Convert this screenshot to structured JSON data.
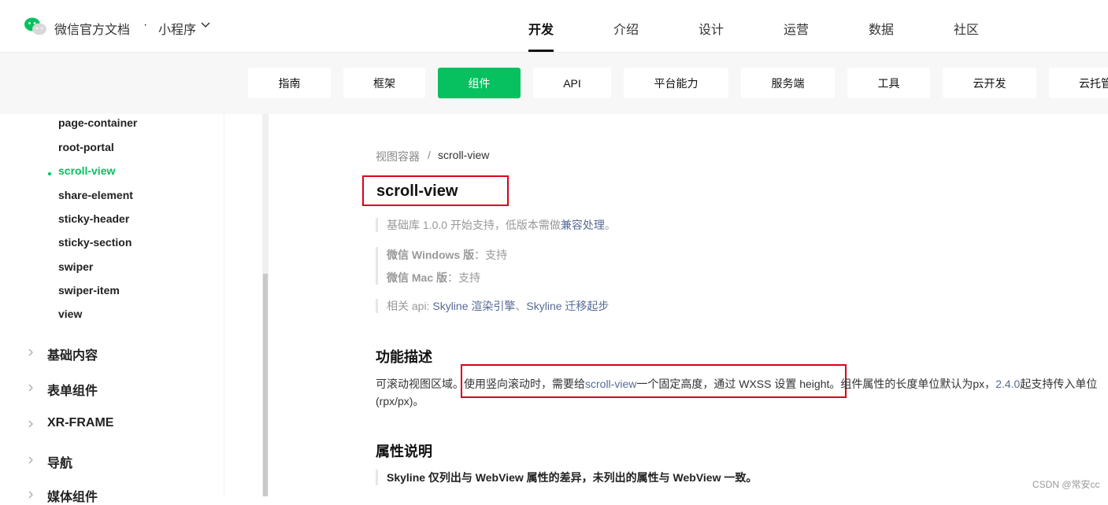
{
  "header": {
    "brand": "微信官方文档",
    "dot": "·",
    "product": "小程序",
    "nav": [
      "开发",
      "介绍",
      "设计",
      "运营",
      "数据",
      "社区"
    ],
    "active_nav": "开发"
  },
  "subnav": {
    "items": [
      "指南",
      "框架",
      "组件",
      "API",
      "平台能力",
      "服务端",
      "工具",
      "云开发",
      "云托管"
    ],
    "active": "组件",
    "accent": "#07c160"
  },
  "sidebar": {
    "sub_items": [
      "page-container",
      "root-portal",
      "scroll-view",
      "share-element",
      "sticky-header",
      "sticky-section",
      "swiper",
      "swiper-item",
      "view"
    ],
    "active_item": "scroll-view",
    "categories": [
      "基础内容",
      "表单组件",
      "XR-FRAME",
      "导航",
      "媒体组件"
    ]
  },
  "main": {
    "breadcrumb": [
      "视图容器",
      "/",
      "scroll-view"
    ],
    "title": "scroll-view",
    "support_note": {
      "prefix": "基础库 1.0.0 开始支持，低版本需做",
      "link": "兼容处理",
      "suffix": "。"
    },
    "windows_note": {
      "label": "微信 Windows 版",
      "value": "：支持"
    },
    "mac_note": {
      "label": "微信 Mac 版",
      "value": "：支持"
    },
    "api_note": {
      "prefix": "相关 api: ",
      "link1": "Skyline 渲染引擎",
      "sep": "、",
      "link2": "Skyline 迁移起步"
    },
    "section1_title": "功能描述",
    "desc": {
      "part1": "可滚动视图区域。",
      "part2": "使用竖向滚动时，需要给",
      "link1": "scroll-view",
      "part3": "一个固定高度，通过 WXSS 设置 height。",
      "part4": "组件属性的长度单位默认为px，",
      "link2": "2.4.0",
      "part5": "起支持传入单位(rpx/px)。"
    },
    "section2_title": "属性说明",
    "skyline_note": "Skyline 仅列出与 WebView 属性的差异，未列出的属性与 WebView 一致。"
  },
  "watermark": "CSDN @常安cc",
  "colors": {
    "accent": "#07c160",
    "highlight": "#d9001b",
    "link": "#576b95"
  }
}
